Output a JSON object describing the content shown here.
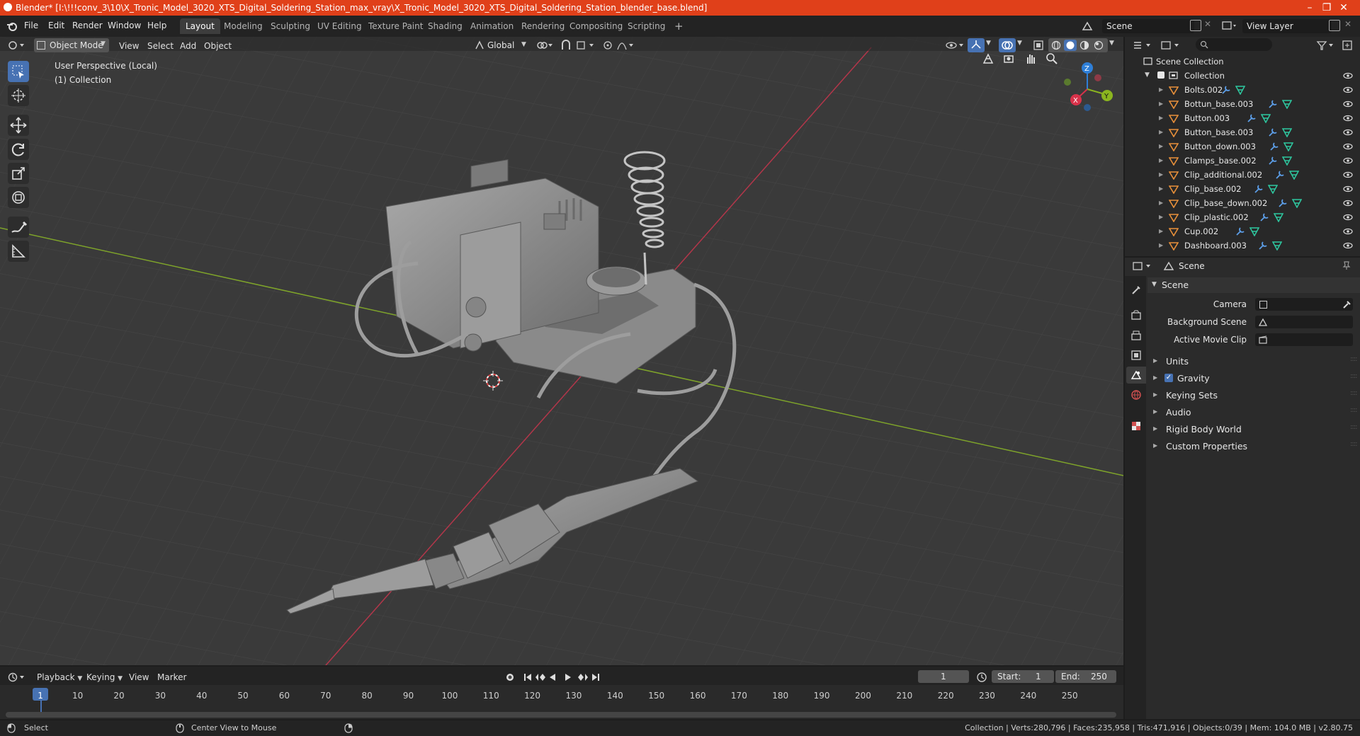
{
  "window": {
    "title": "Blender* [I:\\!!!conv_3\\10\\X_Tronic_Model_3020_XTS_Digital_Soldering_Station_max_vray\\X_Tronic_Model_3020_XTS_Digital_Soldering_Station_blender_base.blend]",
    "minimize": "–",
    "maximize": "❐",
    "close": "✕"
  },
  "menu": [
    "File",
    "Edit",
    "Render",
    "Window",
    "Help"
  ],
  "workspaces": [
    "Layout",
    "Modeling",
    "Sculpting",
    "UV Editing",
    "Texture Paint",
    "Shading",
    "Animation",
    "Rendering",
    "Compositing",
    "Scripting"
  ],
  "workspace_add": "+",
  "scene_selector": "Scene",
  "view_layer": "View Layer",
  "viewport": {
    "mode": "Object Mode",
    "menus": [
      "View",
      "Select",
      "Add",
      "Object"
    ],
    "transform_orientation": "Global",
    "perspective_label": "User Perspective (Local)",
    "collection_label": "(1) Collection",
    "gizmo": {
      "x": "X",
      "y": "Y",
      "z": "Z"
    }
  },
  "outliner": {
    "root": "Scene Collection",
    "collection": "Collection",
    "items": [
      "Bolts.002",
      "Bottun_base.003",
      "Button.003",
      "Button_base.003",
      "Button_down.003",
      "Clamps_base.002",
      "Clip_additional.002",
      "Clip_base.002",
      "Clip_base_down.002",
      "Clip_plastic.002",
      "Cup.002",
      "Dashboard.003"
    ]
  },
  "properties": {
    "context": "Scene",
    "section": "Scene",
    "fields": [
      {
        "label": "Camera"
      },
      {
        "label": "Background Scene"
      },
      {
        "label": "Active Movie Clip"
      }
    ],
    "panels": [
      "Units",
      "Gravity",
      "Keying Sets",
      "Audio",
      "Rigid Body World",
      "Custom Properties"
    ]
  },
  "timeline": {
    "menus": [
      "Playback",
      "Keying",
      "View",
      "Marker"
    ],
    "current_frame": "1",
    "start_label": "Start:",
    "start": "1",
    "end_label": "End:",
    "end": "250",
    "ruler": [
      "1",
      "10",
      "20",
      "30",
      "40",
      "50",
      "60",
      "70",
      "80",
      "90",
      "100",
      "110",
      "120",
      "130",
      "140",
      "150",
      "160",
      "170",
      "180",
      "190",
      "200",
      "210",
      "220",
      "230",
      "240",
      "250"
    ]
  },
  "status": {
    "left_action": "Select",
    "middle_action": "Center View to Mouse",
    "stats": "Collection | Verts:280,796 | Faces:235,958 | Tris:471,916 | Objects:0/39 | Mem: 104.0 MB | v2.80.75"
  },
  "colors": {
    "titlebar": "#e0401a",
    "accent": "#4772b3",
    "x_axis": "#d8324a",
    "y_axis": "#8bb51f",
    "z_axis": "#2e7fd8",
    "mesh_icon": "#e8903a",
    "modifier_icon": "#5c9ee8",
    "data_icon": "#2ec8a0"
  }
}
